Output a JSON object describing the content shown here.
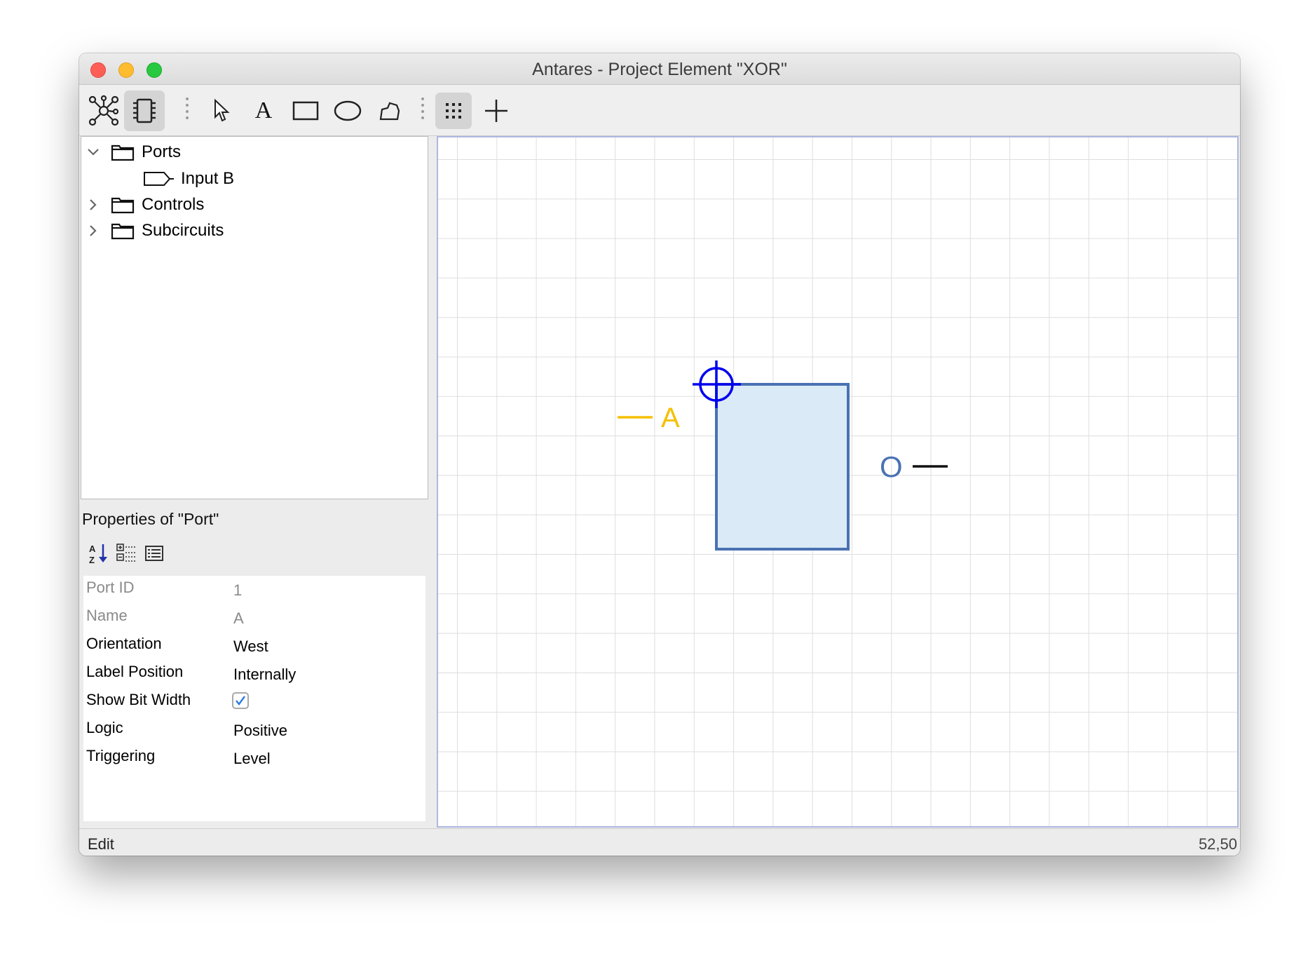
{
  "window": {
    "title": "Antares - Project Element \"XOR\""
  },
  "toolbar": {
    "buttons": [
      {
        "icon": "network-icon",
        "active": false
      },
      {
        "icon": "chip-icon",
        "active": true
      },
      {
        "icon": "pointer-icon",
        "active": false
      },
      {
        "icon": "text-tool-icon",
        "glyph": "A",
        "active": false
      },
      {
        "icon": "rectangle-icon",
        "active": false
      },
      {
        "icon": "ellipse-icon",
        "active": false
      },
      {
        "icon": "polygon-icon",
        "active": false
      },
      {
        "icon": "grid-icon",
        "active": true
      },
      {
        "icon": "crosshair-icon",
        "active": false
      }
    ]
  },
  "tree": {
    "items": [
      {
        "label": "Ports",
        "expanded": true,
        "icon": "folder-icon"
      },
      {
        "label": "Input B",
        "icon": "port-icon"
      },
      {
        "label": "Controls",
        "expanded": false,
        "icon": "folder-icon"
      },
      {
        "label": "Subcircuits",
        "expanded": false,
        "icon": "folder-icon"
      }
    ]
  },
  "properties": {
    "title": "Properties of \"Port\"",
    "tools": [
      "sort-alpha-icon",
      "categorized-icon",
      "list-icon"
    ],
    "rows": [
      {
        "name": "Port ID",
        "value": "1",
        "editable": false
      },
      {
        "name": "Name",
        "value": "A",
        "editable": false
      },
      {
        "name": "Orientation",
        "value": "West",
        "editable": true
      },
      {
        "name": "Label Position",
        "value": "Internally",
        "editable": true
      },
      {
        "name": "Show Bit Width",
        "checked": true,
        "editable": true
      },
      {
        "name": "Logic",
        "value": "Positive",
        "editable": true
      },
      {
        "name": "Triggering",
        "value": "Level",
        "editable": true
      }
    ]
  },
  "canvas": {
    "port_a_label": "A",
    "port_o_label": "O",
    "colors": {
      "selected_port": "#f5c000",
      "body_fill": "#dbeaf7",
      "body_stroke": "#4a72b3",
      "origin": "#0000ee",
      "label_o": "#4a72b3"
    }
  },
  "status": {
    "mode": "Edit",
    "coords": "52,50"
  }
}
